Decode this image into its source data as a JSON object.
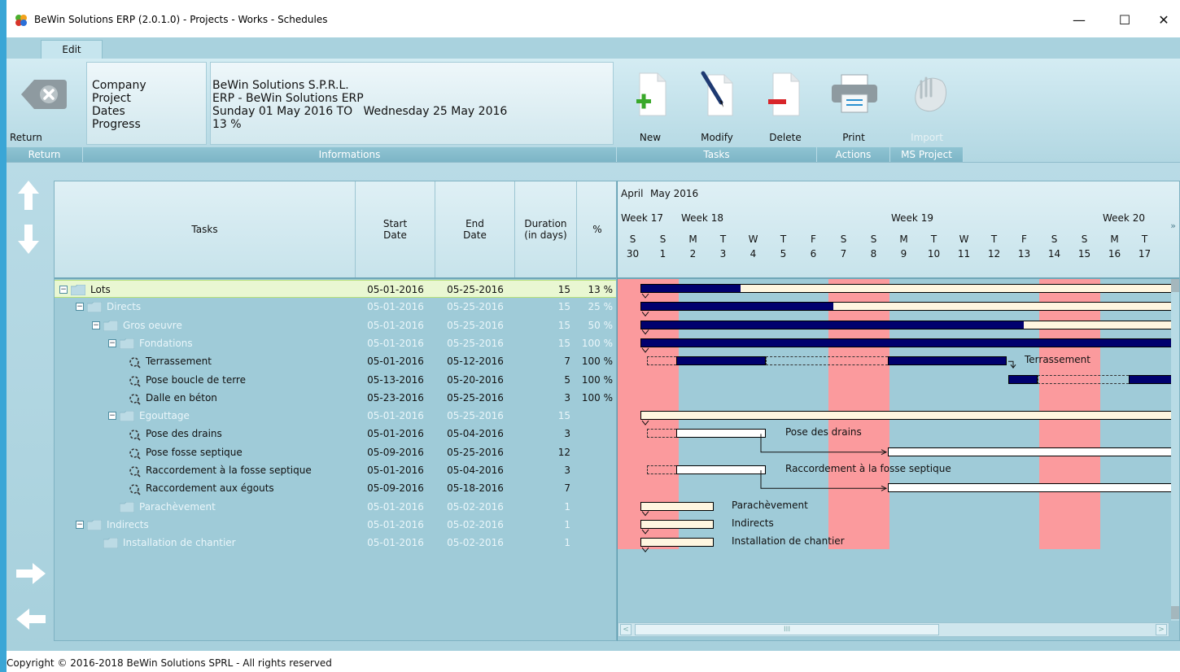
{
  "window": {
    "title": "BeWin Solutions ERP (2.0.1.0) - Projects - Works - Schedules",
    "minimize": "—",
    "maximize": "☐",
    "close": "✕"
  },
  "ribbon": {
    "tab": "Edit",
    "return_label": "Return",
    "groups": {
      "return": "Return",
      "informations": "Informations",
      "tasks": "Tasks",
      "actions": "Actions",
      "ms_project": "MS Project"
    },
    "info": {
      "labels": [
        "Company",
        "Project",
        "Dates",
        "Progress"
      ],
      "company": "BeWin Solutions S.P.R.L.",
      "project": "ERP - BeWin Solutions ERP",
      "dates": "Sunday 01 May 2016 TO   Wednesday 25 May 2016",
      "progress": "13 %"
    },
    "buttons": {
      "new": "New",
      "modify": "Modify",
      "delete": "Delete",
      "print": "Print",
      "import": "Import"
    }
  },
  "grid": {
    "headers": {
      "tasks": "Tasks",
      "start": "Start\nDate",
      "end": "End\nDate",
      "duration": "Duration\n(in days)",
      "percent": "%"
    },
    "rows": [
      {
        "name": "Lots",
        "start": "05-01-2016",
        "end": "05-25-2016",
        "duration": "15",
        "pct": "13 %",
        "level": 0,
        "kind": "folder",
        "exp": "⊟",
        "shade": "dark"
      },
      {
        "name": "Directs",
        "start": "05-01-2016",
        "end": "05-25-2016",
        "duration": "15",
        "pct": "25 %",
        "level": 1,
        "kind": "folder",
        "exp": "⊟",
        "shade": "light"
      },
      {
        "name": "Gros oeuvre",
        "start": "05-01-2016",
        "end": "05-25-2016",
        "duration": "15",
        "pct": "50 %",
        "level": 2,
        "kind": "folder",
        "exp": "⊟",
        "shade": "light"
      },
      {
        "name": "Fondations",
        "start": "05-01-2016",
        "end": "05-25-2016",
        "duration": "15",
        "pct": "100 %",
        "level": 3,
        "kind": "folder",
        "exp": "⊟",
        "shade": "light"
      },
      {
        "name": "Terrassement",
        "start": "05-01-2016",
        "end": "05-12-2016",
        "duration": "7",
        "pct": "100 %",
        "level": 4,
        "kind": "task",
        "shade": "dark"
      },
      {
        "name": "Pose boucle de terre",
        "start": "05-13-2016",
        "end": "05-20-2016",
        "duration": "5",
        "pct": "100 %",
        "level": 4,
        "kind": "task",
        "shade": "dark"
      },
      {
        "name": "Dalle en béton",
        "start": "05-23-2016",
        "end": "05-25-2016",
        "duration": "3",
        "pct": "100 %",
        "level": 4,
        "kind": "task",
        "shade": "dark"
      },
      {
        "name": "Egouttage",
        "start": "05-01-2016",
        "end": "05-25-2016",
        "duration": "15",
        "pct": "",
        "level": 3,
        "kind": "folder",
        "exp": "⊟",
        "shade": "light"
      },
      {
        "name": "Pose des drains",
        "start": "05-01-2016",
        "end": "05-04-2016",
        "duration": "3",
        "pct": "",
        "level": 4,
        "kind": "task",
        "shade": "dark"
      },
      {
        "name": "Pose fosse septique",
        "start": "05-09-2016",
        "end": "05-25-2016",
        "duration": "12",
        "pct": "",
        "level": 4,
        "kind": "task",
        "shade": "dark"
      },
      {
        "name": "Raccordement à la fosse septique",
        "start": "05-01-2016",
        "end": "05-04-2016",
        "duration": "3",
        "pct": "",
        "level": 4,
        "kind": "task",
        "shade": "dark"
      },
      {
        "name": "Raccordement aux égouts",
        "start": "05-09-2016",
        "end": "05-18-2016",
        "duration": "7",
        "pct": "",
        "level": 4,
        "kind": "task",
        "shade": "dark"
      },
      {
        "name": "Parachèvement",
        "start": "05-01-2016",
        "end": "05-02-2016",
        "duration": "1",
        "pct": "",
        "level": 3,
        "kind": "folder",
        "shade": "light"
      },
      {
        "name": "Indirects",
        "start": "05-01-2016",
        "end": "05-02-2016",
        "duration": "1",
        "pct": "",
        "level": 1,
        "kind": "folder",
        "exp": "⊟",
        "shade": "light"
      },
      {
        "name": "Installation de chantier",
        "start": "05-01-2016",
        "end": "05-02-2016",
        "duration": "1",
        "pct": "",
        "level": 2,
        "kind": "folder",
        "shade": "light"
      }
    ]
  },
  "gantt": {
    "months": [
      "April",
      "May 2016"
    ],
    "weeks": [
      "Week 17",
      "Week 18",
      "Week 19",
      "Week 20"
    ],
    "days": [
      [
        "S",
        "30"
      ],
      [
        "S",
        "1"
      ],
      [
        "M",
        "2"
      ],
      [
        "T",
        "3"
      ],
      [
        "W",
        "4"
      ],
      [
        "T",
        "5"
      ],
      [
        "F",
        "6"
      ],
      [
        "S",
        "7"
      ],
      [
        "S",
        "8"
      ],
      [
        "M",
        "9"
      ],
      [
        "T",
        "10"
      ],
      [
        "W",
        "11"
      ],
      [
        "T",
        "12"
      ],
      [
        "F",
        "13"
      ],
      [
        "S",
        "14"
      ],
      [
        "S",
        "15"
      ],
      [
        "M",
        "16"
      ],
      [
        "T",
        "17"
      ]
    ],
    "bar_labels": {
      "terrassement": "Terrassement",
      "drains": "Pose des drains",
      "raccordement": "Raccordement à la fosse septique",
      "parachevement": "Parachèvement",
      "indirects": "Indirects",
      "installation": "Installation de chantier"
    },
    "scroll_thumb": "III",
    "colors": {
      "weekend": "#fb9a9d",
      "progress": "#00006e",
      "planned": "#fff6e0"
    }
  },
  "status": {
    "copyright": "Copyright © 2016-2018 BeWin Solutions SPRL - All rights reserved"
  }
}
